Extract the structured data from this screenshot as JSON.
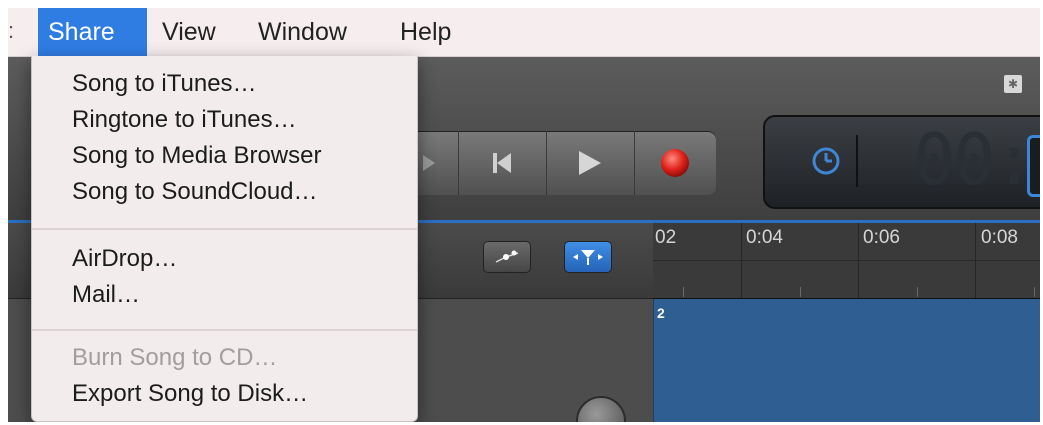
{
  "menubar": {
    "edge_glyph": ":",
    "items": [
      {
        "label": "Share"
      },
      {
        "label": "View"
      },
      {
        "label": "Window"
      },
      {
        "label": "Help"
      }
    ]
  },
  "share_menu": {
    "items": [
      {
        "label": "Song to iTunes…",
        "enabled": true
      },
      {
        "label": "Ringtone to iTunes…",
        "enabled": true
      },
      {
        "label": "Song to Media Browser",
        "enabled": true
      },
      {
        "label": "Song to SoundCloud…",
        "enabled": true
      },
      {
        "label": "AirDrop…",
        "enabled": true
      },
      {
        "label": "Mail…",
        "enabled": true
      },
      {
        "label": "Burn Song to CD…",
        "enabled": false
      },
      {
        "label": "Export Song to Disk…",
        "enabled": true
      }
    ]
  },
  "timeline": {
    "ruler_labels": [
      "02",
      "0:04",
      "0:06",
      "0:08"
    ],
    "region_label": "2"
  },
  "lcd": {
    "time_partial": "00:"
  },
  "colors": {
    "menu_highlight": "#2f7ce3",
    "record_button": "#e0221b",
    "region_fill": "#2f5e93",
    "accent_blue": "#2b6fc2"
  }
}
